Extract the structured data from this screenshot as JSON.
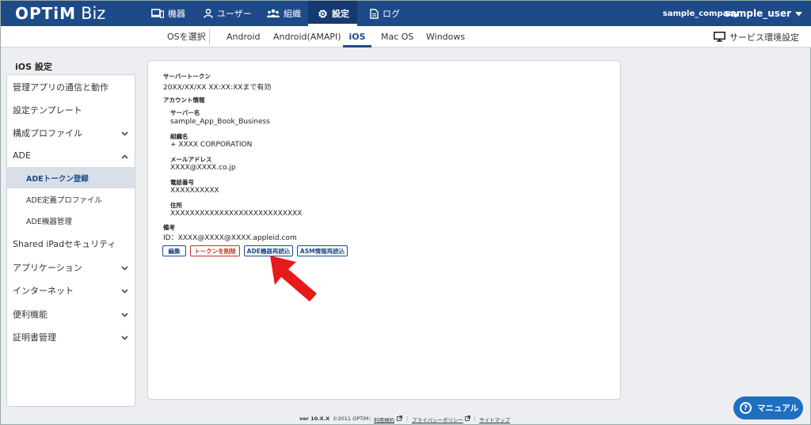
{
  "header": {
    "logo_main": "OPTiM",
    "logo_sub": "Biz",
    "nav": [
      {
        "label": "機器"
      },
      {
        "label": "ユーザー"
      },
      {
        "label": "組織"
      },
      {
        "label": "設定"
      },
      {
        "label": "ログ"
      }
    ],
    "company": "sample_company",
    "user": "sample_user"
  },
  "subnav": {
    "select_os": "OSを選択",
    "tabs": [
      "Android",
      "Android(AMAPI)",
      "iOS",
      "Mac OS",
      "Windows"
    ],
    "service_settings": "サービス環境設定"
  },
  "sidebar": {
    "title": "iOS 設定",
    "items": [
      {
        "label": "管理アプリの通信と動作"
      },
      {
        "label": "設定テンプレート"
      },
      {
        "label": "構成プロファイル"
      },
      {
        "label": "ADE"
      },
      {
        "label": "ADEトークン登録"
      },
      {
        "label": "ADE定義プロファイル"
      },
      {
        "label": "ADE機器管理"
      },
      {
        "label": "Shared iPadセキュリティ"
      },
      {
        "label": "アプリケーション"
      },
      {
        "label": "インターネット"
      },
      {
        "label": "便利機能"
      },
      {
        "label": "証明書管理"
      }
    ]
  },
  "content": {
    "server_token_label": "サーバートークン",
    "server_token_value": "20XX/XX/XX XX:XX:XXまで有効",
    "account_info_label": "アカウント情報",
    "server_name_label": "サーバー名",
    "server_name_value": "sample_App_Book_Business",
    "org_name_label": "組織名",
    "org_name_value": "+ XXXX CORPORATION",
    "email_label": "メールアドレス",
    "email_value": "XXXX@XXXX.co.jp",
    "phone_label": "電話番号",
    "phone_value": "XXXXXXXXXX",
    "address_label": "住所",
    "address_value": "XXXXXXXXXXXXXXXXXXXXXXXXXXX",
    "note_label": "備考",
    "note_value": "ID：XXXX@XXXX@XXXX.appleid.com",
    "buttons": {
      "edit": "編集",
      "delete_token": "トークンを削除",
      "reload_ade": "ADE機器再読込",
      "reload_asm": "ASM情報再読込"
    }
  },
  "footer": {
    "version": "ver 10.X.X",
    "copyright": "©2011 OPTiM",
    "terms": "利用規約",
    "privacy": "プライバシーポリシー",
    "sitemap": "サイトマップ"
  },
  "manual_button": "マニュアル",
  "colors": {
    "header_bg": "#1e4a8a",
    "accent": "#1e4a8a",
    "danger": "#c0302a",
    "arrow": "#e8191b",
    "manual_bg": "#1f6fc0"
  }
}
